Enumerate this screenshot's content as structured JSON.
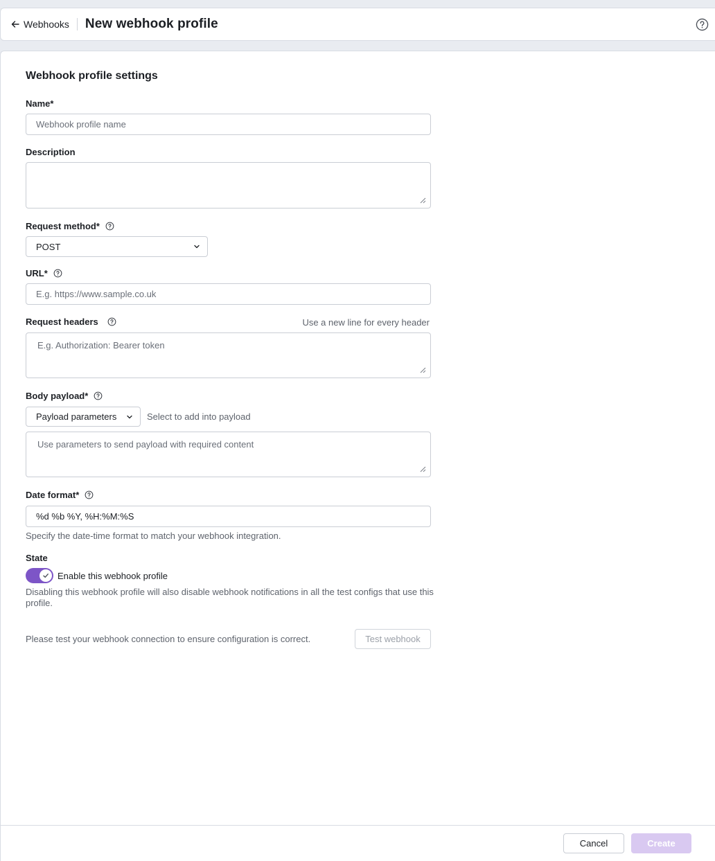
{
  "header": {
    "back_label": "Webhooks",
    "title": "New webhook profile",
    "icons": {
      "back": "arrow-left-icon",
      "help": "help-circle-icon"
    }
  },
  "form": {
    "section_title": "Webhook profile settings",
    "name": {
      "label": "Name*",
      "placeholder": "Webhook profile name",
      "value": ""
    },
    "description": {
      "label": "Description",
      "value": ""
    },
    "request_method": {
      "label": "Request method*",
      "value": "POST",
      "options": [
        "POST"
      ]
    },
    "url": {
      "label": "URL*",
      "placeholder": "E.g. https://www.sample.co.uk",
      "value": ""
    },
    "request_headers": {
      "label": "Request headers",
      "hint": "Use a new line for every header",
      "placeholder": "E.g. Authorization: Bearer token",
      "value": ""
    },
    "body_payload": {
      "label": "Body payload*",
      "select_label": "Payload parameters",
      "select_hint": "Select to add into payload",
      "placeholder": "Use parameters to send payload with required content",
      "value": ""
    },
    "date_format": {
      "label": "Date format*",
      "value": "%d %b %Y, %H:%M:%S",
      "hint": "Specify the date-time format to match your webhook integration."
    },
    "state": {
      "label": "State",
      "enabled": true,
      "toggle_label": "Enable this webhook profile",
      "warning": "Disabling this webhook profile will also disable webhook notifications in all the test configs that use this profile."
    },
    "test": {
      "message": "Please test your webhook connection to ensure configuration is correct.",
      "button_label": "Test webhook"
    }
  },
  "footer": {
    "cancel_label": "Cancel",
    "create_label": "Create"
  },
  "colors": {
    "accent": "#7d55c7",
    "create_disabled": "#d9c9f1",
    "background": "#e9ecf1"
  }
}
